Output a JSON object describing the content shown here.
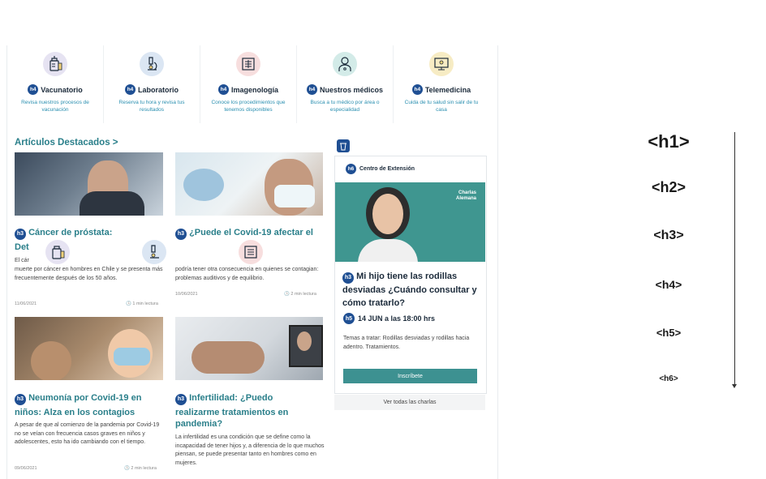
{
  "colors": {
    "accent": "#2a7f8a",
    "badge": "#1f4f93",
    "button": "#3d9191"
  },
  "services": [
    {
      "title": "Vacunatorio",
      "desc": "Revisa nuestros procesos de vacunación",
      "badge": "h4",
      "icon": "vaccine-icon"
    },
    {
      "title": "Laboratorio",
      "desc": "Reserva tu hora y revisa tus resultados",
      "badge": "h4",
      "icon": "microscope-icon"
    },
    {
      "title": "Imagenología",
      "desc": "Conoce los procedimientos que tenemos disponibles",
      "badge": "h4",
      "icon": "xray-icon"
    },
    {
      "title": "Nuestros médicos",
      "desc": "Busca a tu médico por área o especialidad",
      "badge": "h4",
      "icon": "doctor-icon"
    },
    {
      "title": "Telemedicina",
      "desc": "Cuida de tu salud sin salir de tu casa",
      "badge": "h4",
      "icon": "telemedicine-icon"
    }
  ],
  "section": {
    "title": "Artículos Destacados >"
  },
  "articles": [
    {
      "badge": "h3",
      "title": "Cáncer de próstata:",
      "title2": "Det",
      "body_frag": "El cár",
      "body": "muerte por cáncer en hombres en Chile y se presenta más frecuentemente después de los 50 años.",
      "date": "11/06/2021",
      "read": "1 min lectura"
    },
    {
      "badge": "h3",
      "title": "¿Puede el Covid-19 afectar el",
      "body": "podría tener otra consecuencia en quienes se contagian: problemas auditivos y de equilibrio.",
      "date": "10/06/2021",
      "read": "2 min lectura"
    },
    {
      "badge": "h3",
      "title": "Neumonía por Covid-19 en",
      "title2": "niños: Alza en los contagios",
      "body": "A pesar de que al comienzo de la pandemia por Covid-19 no se veían con frecuencia casos graves en niños y adolescentes, esto ha ido cambiando con el tiempo.",
      "date": "09/06/2021",
      "read": "2 min lectura"
    },
    {
      "badge": "h3",
      "title": "Infertilidad: ¿Puedo",
      "title2": "realizarme tratamientos en",
      "title3": "pandemia?",
      "body": "La infertilidad es una condición que se define como la incapacidad de tener hijos y, a diferencia de lo que muchos piensan, se puede presentar tanto en hombres como en mujeres."
    }
  ],
  "sidebar": {
    "center_badge": "h6",
    "center": "Centro de Extensión",
    "promo": "Charlas Alemana",
    "badge": "h3",
    "talk_title": "Mi hijo tiene las rodillas desviadas ¿Cuándo consultar y cómo tratarlo?",
    "date_badge": "h5",
    "date": "14 JUN a las 18:00 hrs",
    "topics": "Temas a tratar: Rodillas desviadas y rodillas hacia adentro. Tratamientos.",
    "button": "Inscríbete",
    "view_all": "Ver todas las charlas"
  },
  "heading_scale": [
    "<h1>",
    "<h2>",
    "<h3>",
    "<h4>",
    "<h5>",
    "<h6>"
  ]
}
